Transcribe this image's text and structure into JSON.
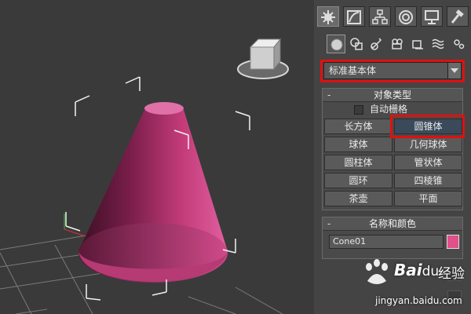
{
  "viewport": {
    "object_color": "#c43c7a",
    "grid_color": "#8a8a8a",
    "bracket_color": "#f2f2f2"
  },
  "command_panel": {
    "tabs": [
      "create-tab",
      "modify-tab",
      "hierarchy-tab",
      "motion-tab",
      "display-tab",
      "utilities-tab"
    ],
    "sub_tabs": [
      "geometry-icon",
      "shapes-icon",
      "lights-icon",
      "cameras-icon",
      "helpers-icon",
      "spacewarps-icon",
      "systems-icon"
    ],
    "category": "标准基本体",
    "object_type": {
      "title": "对象类型",
      "autogrid_label": "自动栅格",
      "buttons": [
        "长方体",
        "圆锥体",
        "球体",
        "几何球体",
        "圆柱体",
        "管状体",
        "圆环",
        "四棱锥",
        "茶壶",
        "平面"
      ],
      "selected": "圆锥体"
    },
    "name_color": {
      "title": "名称和颜色",
      "name_value": "Cone01",
      "color": "#e0508a"
    }
  },
  "highlight_color": "#e01010",
  "watermark": {
    "brand": "Bai",
    "brand_suffix": "du",
    "product": "经验",
    "url": "jingyan.baidu.com"
  }
}
